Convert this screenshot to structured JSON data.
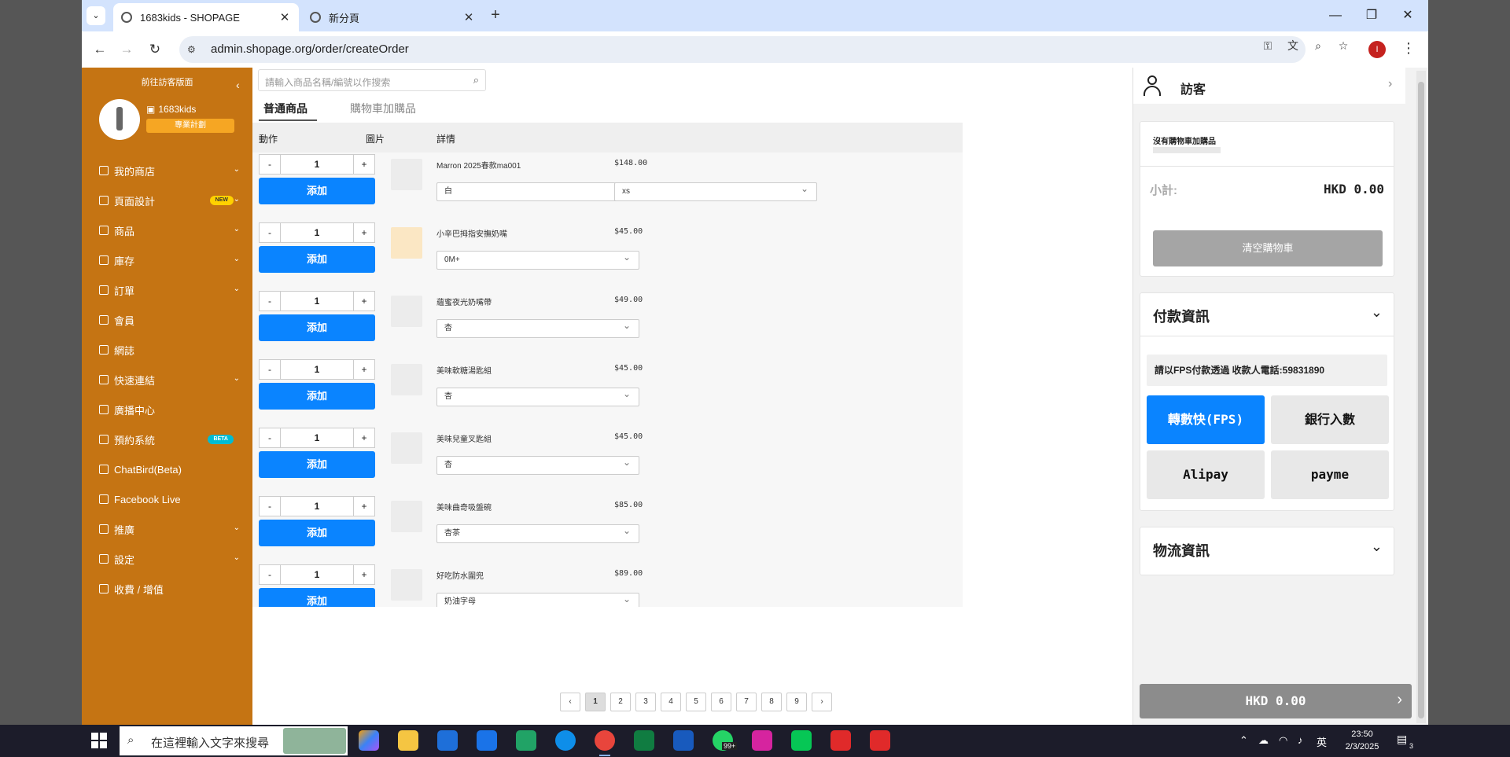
{
  "browser": {
    "tabs": [
      {
        "label": "1683kids - SHOPAGE",
        "active": true
      },
      {
        "label": "新分頁",
        "active": false
      }
    ],
    "url": "admin.shopage.org/order/createOrder",
    "profile_initial": "I"
  },
  "sidebar": {
    "top_link": "前往訪客版面",
    "store_name": "1683kids",
    "plan_button": "專業計劃",
    "items": [
      {
        "label": "我的商店",
        "icon": "home-icon",
        "chevron": true
      },
      {
        "label": "頁面設計",
        "icon": "layout-icon",
        "badge": "NEW",
        "chevron": true
      },
      {
        "label": "商品",
        "icon": "list-icon",
        "chevron": true
      },
      {
        "label": "庫存",
        "icon": "stock-icon",
        "chevron": true
      },
      {
        "label": "訂單",
        "icon": "cart-icon",
        "chevron": true
      },
      {
        "label": "會員",
        "icon": "members-icon",
        "chevron": false
      },
      {
        "label": "網誌",
        "icon": "blog-icon",
        "chevron": false
      },
      {
        "label": "快速連結",
        "icon": "link-icon",
        "chevron": true
      },
      {
        "label": "廣播中心",
        "icon": "broadcast-icon",
        "chevron": false
      },
      {
        "label": "預約系統",
        "icon": "clock-icon",
        "badge": "BETA",
        "chevron": false
      },
      {
        "label": "ChatBird(Beta)",
        "icon": "globe-icon",
        "chevron": false
      },
      {
        "label": "Facebook Live",
        "icon": "video-icon",
        "chevron": false
      },
      {
        "label": "推廣",
        "icon": "promote-icon",
        "chevron": true
      },
      {
        "label": "設定",
        "icon": "settings-icon",
        "chevron": true
      },
      {
        "label": "收費 / 增值",
        "icon": "star-icon",
        "chevron": false
      }
    ]
  },
  "main": {
    "search_placeholder": "請輸入商品名稱/編號以作搜索",
    "tabs": [
      "普通商品",
      "購物車加購品"
    ],
    "columns": [
      "動作",
      "圖片",
      "詳情"
    ],
    "add_label": "添加",
    "products": [
      {
        "name": "Marron 2025春款ma001",
        "price": "$148.00",
        "qty": "1",
        "options": [
          "白",
          "xs"
        ]
      },
      {
        "name": "小辛巴拇指安撫奶嘴",
        "price": "$45.00",
        "qty": "1",
        "options": [
          "0M+"
        ]
      },
      {
        "name": "蘊蜜夜光奶嘴帶",
        "price": "$49.00",
        "qty": "1",
        "options": [
          "杏"
        ]
      },
      {
        "name": "美味軟糖湯匙組",
        "price": "$45.00",
        "qty": "1",
        "options": [
          "杏"
        ]
      },
      {
        "name": "美味兒童叉匙組",
        "price": "$45.00",
        "qty": "1",
        "options": [
          "杏"
        ]
      },
      {
        "name": "美味曲奇吸盤碗",
        "price": "$85.00",
        "qty": "1",
        "options": [
          "杏茶"
        ]
      },
      {
        "name": "好吃防水圍兜",
        "price": "$89.00",
        "qty": "1",
        "options": [
          "奶油字母"
        ]
      }
    ],
    "pages": [
      "1",
      "2",
      "3",
      "4",
      "5",
      "6",
      "7",
      "8",
      "9"
    ],
    "current_page": "1"
  },
  "right": {
    "customer": "訪客",
    "no_addon": "沒有購物車加購品",
    "subtotal_label": "小計:",
    "subtotal_value": "HKD 0.00",
    "clear_cart": "清空購物車",
    "payment_title": "付款資訊",
    "fps_note": "請以FPS付款透過 收款人電話:59831890",
    "payment_methods": [
      "轉數快(FPS)",
      "銀行入數",
      "Alipay",
      "payme"
    ],
    "active_method": "轉數快(FPS)",
    "logistics_title": "物流資訊",
    "checkout_total": "HKD 0.00"
  },
  "taskbar": {
    "search_placeholder": "在這裡輸入文字來搜尋",
    "time": "23:50",
    "date": "2/3/2025",
    "ime": "英",
    "whatsapp_badge": "99+",
    "notification_count": "3"
  },
  "colors": {
    "sidebar": "#c57413",
    "primary": "#0a84ff",
    "tabstrip": "#d3e3fd"
  }
}
